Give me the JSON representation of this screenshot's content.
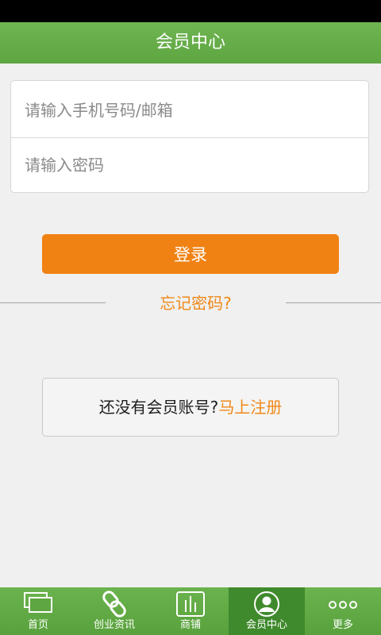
{
  "header": {
    "title": "会员中心"
  },
  "login": {
    "account_placeholder": "请输入手机号码/邮箱",
    "password_placeholder": "请输入密码",
    "login_label": "登录",
    "forgot_label": "忘记密码?"
  },
  "register": {
    "prompt": "还没有会员账号?",
    "link": "马上注册"
  },
  "tabs": [
    {
      "label": "首页",
      "icon": "home-icon",
      "active": false
    },
    {
      "label": "创业资讯",
      "icon": "link-icon",
      "active": false
    },
    {
      "label": "商铺",
      "icon": "store-icon",
      "active": false
    },
    {
      "label": "会员中心",
      "icon": "user-icon",
      "active": true
    },
    {
      "label": "更多",
      "icon": "more-icon",
      "active": false
    }
  ],
  "colors": {
    "header_green": "#5ea641",
    "accent_orange": "#f08214",
    "active_tab": "#3f8a2c"
  }
}
